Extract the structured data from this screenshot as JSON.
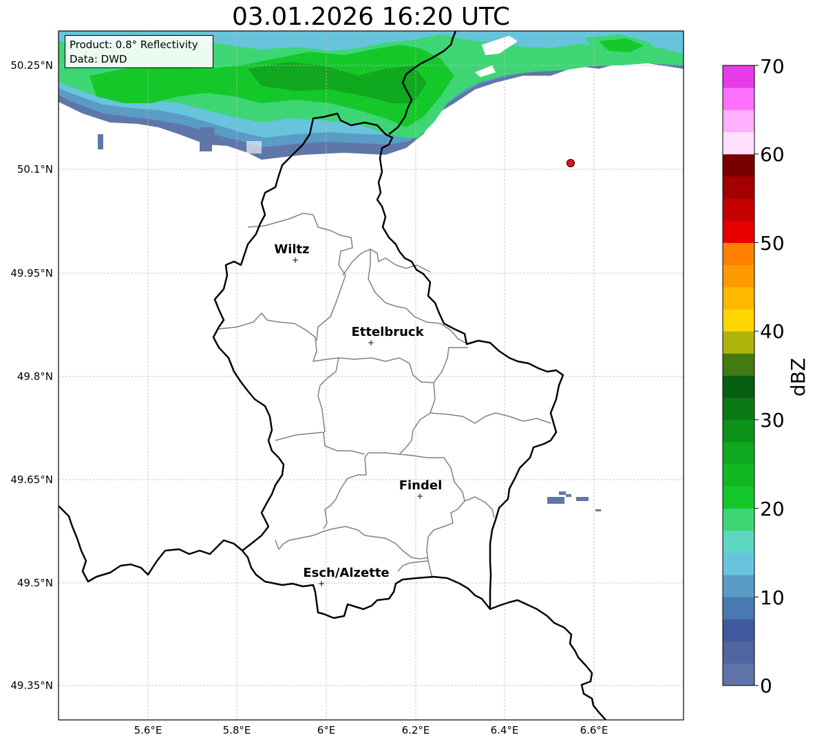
{
  "title": "03.01.2026 16:20 UTC",
  "info": {
    "product": "Product: 0.8° Reflectivity",
    "data": "Data: DWD"
  },
  "axes": {
    "lat_ticks": [
      "50.25°N",
      "50.1°N",
      "49.95°N",
      "49.8°N",
      "49.65°N",
      "49.5°N",
      "49.35°N"
    ],
    "lon_ticks": [
      "5.6°E",
      "5.8°E",
      "6°E",
      "6.2°E",
      "6.4°E",
      "6.6°E"
    ],
    "grid": true
  },
  "cities": [
    {
      "name": "Wiltz"
    },
    {
      "name": "Ettelbruck"
    },
    {
      "name": "Findel"
    },
    {
      "name": "Esch/Alzette"
    }
  ],
  "colorbar": {
    "label": "dBZ",
    "ticks": [
      "0",
      "10",
      "20",
      "30",
      "40",
      "50",
      "60",
      "70"
    ],
    "colors": [
      "#5f73a6",
      "#4f65a0",
      "#3f5aa0",
      "#4a78b0",
      "#5a9cc6",
      "#68c4dc",
      "#5ed6c4",
      "#3ed674",
      "#14c82a",
      "#12b824",
      "#10a81e",
      "#0d921a",
      "#0b7a16",
      "#085e12",
      "#447a12",
      "#aeb40a",
      "#ffd700",
      "#ffb700",
      "#ff9900",
      "#ff7f00",
      "#e60000",
      "#c40000",
      "#a40000",
      "#7a0000",
      "#ffe0ff",
      "#ffb0ff",
      "#ff70ff",
      "#e83ae8"
    ]
  },
  "colors": {
    "border": "#000000",
    "cantons": "#808080",
    "marker": "#e8101a"
  }
}
